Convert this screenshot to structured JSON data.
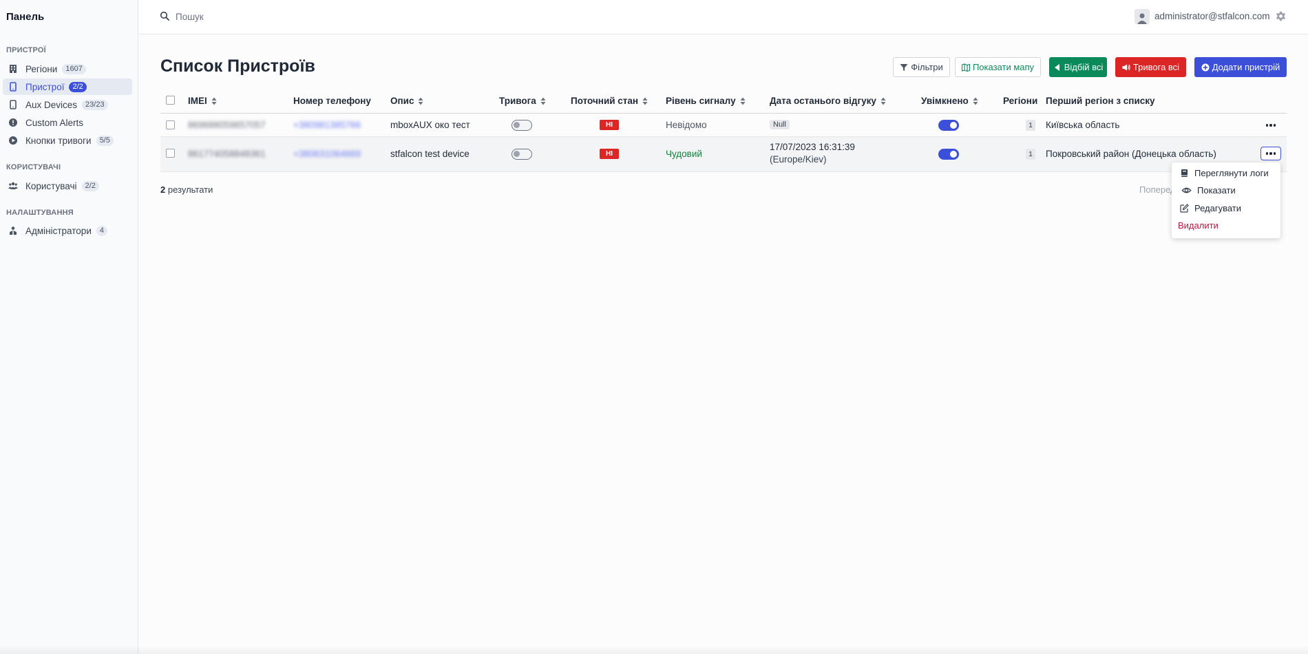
{
  "sidebar": {
    "brand": "Панель",
    "sections": {
      "devices": "ПРИСТРОЇ",
      "users": "КОРИСТУВАЧІ",
      "settings": "НАЛАШТУВАННЯ"
    },
    "items": [
      {
        "label": "Регіони",
        "badge": "1607",
        "icon": "building-icon"
      },
      {
        "label": "Пристрої",
        "badge": "2/2",
        "icon": "phone-icon"
      },
      {
        "label": "Aux Devices",
        "badge": "23/23",
        "icon": "phone-icon"
      },
      {
        "label": "Custom Alerts",
        "badge": "",
        "icon": "alert-circle-icon"
      },
      {
        "label": "Кнопки тривоги",
        "badge": "5/5",
        "icon": "play-circle-icon"
      },
      {
        "label": "Користувачі",
        "badge": "2/2",
        "icon": "users-icon"
      },
      {
        "label": "Адміністратори",
        "badge": "4",
        "icon": "admin-icon"
      }
    ]
  },
  "topbar": {
    "search_placeholder": "Пошук",
    "user_email": "administrator@stfalcon.com"
  },
  "page": {
    "title": "Список Пристроїв",
    "buttons": {
      "filters": "Фільтри",
      "show_map": "Показати мапу",
      "cancel_all": "Відбій всі",
      "alarm_all": "Тривога всі",
      "add_device": "Додати пристрій"
    }
  },
  "table": {
    "columns": {
      "imei": "IMEI",
      "phone": "Номер телефону",
      "description": "Опис",
      "alarm": "Тривога",
      "state": "Поточний стан",
      "signal": "Рівень сигналу",
      "last_response": "Дата останього відгуку",
      "enabled": "Увімкнено",
      "regions": "Регіони",
      "first_region": "Перший регіон з списку"
    },
    "rows": [
      {
        "imei": "869688059657057",
        "phone": "+380981385766",
        "description": "mboxAUX око тест",
        "alarm": false,
        "state": "HI",
        "signal": "Невідомо",
        "signal_color": "#4b5563",
        "last_response": "Null",
        "last_response_tz": "",
        "enabled": true,
        "regions": "1",
        "first_region": "Київська область"
      },
      {
        "imei": "861774058848361",
        "phone": "+380631064669",
        "description": "stfalcon test device",
        "alarm": false,
        "state": "HI",
        "signal": "Чудовий",
        "signal_color": "#15803d",
        "last_response": "17/07/2023 16:31:39",
        "last_response_tz": "(Europe/Kiev)",
        "enabled": true,
        "regions": "1",
        "first_region": "Покровський район (Донецька область)"
      }
    ],
    "results_count": "2",
    "results_label": "результати",
    "pager_prev": "Попередня"
  },
  "row_menu": {
    "view_logs": "Переглянути логи",
    "show": "Показати",
    "edit": "Редагувати",
    "delete": "Видалити"
  },
  "colors": {
    "accent": "#3b4fd9",
    "success": "#0a8a5a",
    "danger": "#dc2626",
    "delete_text": "#be123c"
  }
}
